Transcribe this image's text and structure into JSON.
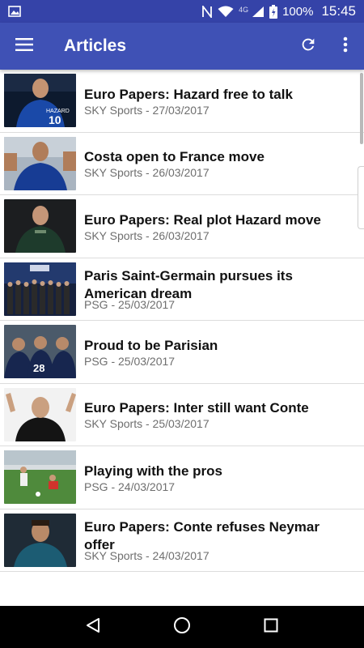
{
  "status_bar": {
    "network_type": "4G",
    "battery": "100%",
    "time": "15:45"
  },
  "app_bar": {
    "title": "Articles",
    "menu_icon": "hamburger-menu-icon",
    "refresh_icon": "refresh-icon",
    "overflow_icon": "more-vertical-icon",
    "background": "#3f51b5",
    "status_background": "#3543a8"
  },
  "articles": [
    {
      "headline": "Euro Papers: Hazard free to talk",
      "meta": "SKY Sports - 27/03/2017",
      "thumb_icon": "player-photo-icon"
    },
    {
      "headline": "Costa open to France move",
      "meta": "SKY Sports - 26/03/2017",
      "thumb_icon": "player-photo-icon"
    },
    {
      "headline": "Euro Papers: Real plot Hazard move",
      "meta": "SKY Sports - 26/03/2017",
      "thumb_icon": "player-photo-icon"
    },
    {
      "headline": "Paris Saint-Germain pursues its American dream",
      "meta": "PSG - 25/03/2017",
      "thumb_icon": "press-event-photo-icon"
    },
    {
      "headline": "Proud to be Parisian",
      "meta": "PSG - 25/03/2017",
      "thumb_icon": "team-photo-icon"
    },
    {
      "headline": "Euro Papers: Inter still want Conte",
      "meta": "SKY Sports - 25/03/2017",
      "thumb_icon": "coach-photo-icon"
    },
    {
      "headline": "Playing with the pros",
      "meta": "PSG - 24/03/2017",
      "thumb_icon": "training-photo-icon"
    },
    {
      "headline": "Euro Papers: Conte refuses Neymar offer",
      "meta": "SKY Sports - 24/03/2017",
      "thumb_icon": "player-photo-icon"
    }
  ],
  "nav_bar": {
    "back_icon": "back-triangle-icon",
    "home_icon": "home-circle-icon",
    "recents_icon": "recents-square-icon"
  }
}
